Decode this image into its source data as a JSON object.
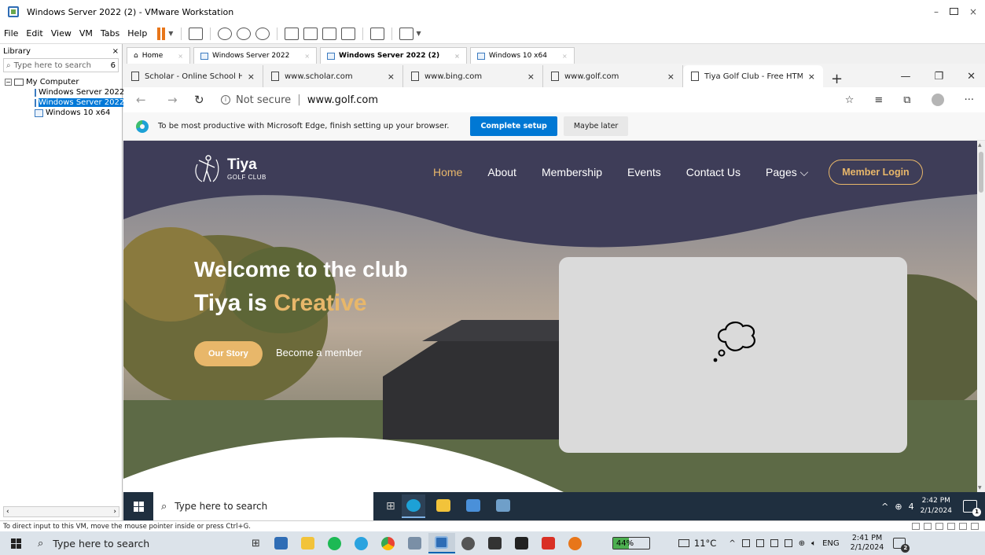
{
  "vmware": {
    "title": "Windows Server 2022 (2) - VMware Workstation",
    "menu": [
      "File",
      "Edit",
      "View",
      "VM",
      "Tabs",
      "Help"
    ],
    "library": {
      "title": "Library",
      "close": "×",
      "search_placeholder": "Type here to search",
      "search_count": "6",
      "root": "My Computer",
      "vms": [
        "Windows Server 2022",
        "Windows Server 2022",
        "Windows 10 x64"
      ],
      "selected_index": 1
    },
    "tabs": [
      {
        "label": "Home",
        "active": false
      },
      {
        "label": "Windows Server 2022",
        "active": false
      },
      {
        "label": "Windows Server 2022 (2)",
        "active": true
      },
      {
        "label": "Windows 10 x64",
        "active": false
      }
    ],
    "status_text": "To direct input to this VM, move the mouse pointer inside or press Ctrl+G."
  },
  "edge": {
    "tabs": [
      {
        "label": "Scholar - Online School HTML",
        "active": false
      },
      {
        "label": "www.scholar.com",
        "active": false
      },
      {
        "label": "www.bing.com",
        "active": false
      },
      {
        "label": "www.golf.com",
        "active": false
      },
      {
        "label": "Tiya Golf Club - Free HTML CS",
        "active": true
      }
    ],
    "security": "Not secure",
    "url": "www.golf.com",
    "notice": {
      "message": "To be most productive with Microsoft Edge, finish setting up your browser.",
      "primary": "Complete setup",
      "secondary": "Maybe later"
    }
  },
  "site": {
    "logo_name": "Tiya",
    "logo_sub": "GOLF CLUB",
    "nav": [
      {
        "label": "Home",
        "active": true
      },
      {
        "label": "About",
        "active": false
      },
      {
        "label": "Membership",
        "active": false
      },
      {
        "label": "Events",
        "active": false
      },
      {
        "label": "Contact Us",
        "active": false
      },
      {
        "label": "Pages",
        "active": false
      }
    ],
    "login": "Member Login",
    "hero_sub": "Welcome to the club",
    "hero_title_a": "Tiya is",
    "hero_title_b": "Creative",
    "btn_story": "Our Story",
    "link_member": "Become a member",
    "colors": {
      "accent": "#e8b76a",
      "header": "#3e3d58"
    }
  },
  "guest_taskbar": {
    "search": "Type here to search",
    "lang": "4",
    "time": "2:42 PM",
    "date": "2/1/2024",
    "notifications": "1"
  },
  "host_taskbar": {
    "search": "Type here to search",
    "battery": "44%",
    "battery_level": 44,
    "temp": "11°C",
    "lang": "ENG",
    "time": "2:41 PM",
    "date": "2/1/2024",
    "notifications": "2"
  }
}
